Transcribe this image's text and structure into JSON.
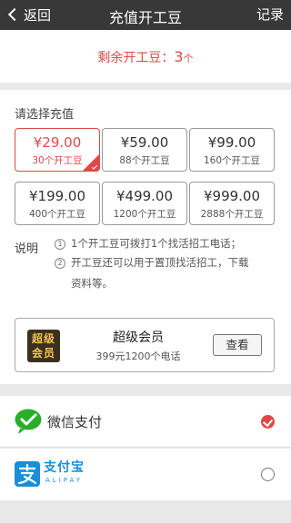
{
  "header": {
    "back_label": "返回",
    "title": "充值开工豆",
    "records_label": "记录"
  },
  "balance": {
    "label": "剩余开工豆：",
    "value": "3",
    "unit": "个"
  },
  "recharge": {
    "section_label": "请选择充值",
    "options": [
      {
        "price": "¥29.00",
        "beans": "30个开工豆",
        "selected": true
      },
      {
        "price": "¥59.00",
        "beans": "88个开工豆",
        "selected": false
      },
      {
        "price": "¥99.00",
        "beans": "160个开工豆",
        "selected": false
      },
      {
        "price": "¥199.00",
        "beans": "400个开工豆",
        "selected": false
      },
      {
        "price": "¥499.00",
        "beans": "1200个开工豆",
        "selected": false
      },
      {
        "price": "¥999.00",
        "beans": "2888个开工豆",
        "selected": false
      }
    ]
  },
  "notes": {
    "label": "说明",
    "items": [
      {
        "index": "1",
        "text": "1个开工豆可拨打1个找活招工电话；"
      },
      {
        "index": "2",
        "text": "开工豆还可以用于置顶找活招工，下载",
        "text2": "资料等。"
      }
    ]
  },
  "vip": {
    "logo_line1": "超级",
    "logo_line2": "会员",
    "name": "超级会员",
    "desc": "399元1200个电话",
    "button_label": "查看"
  },
  "payment": {
    "wechat": {
      "label": "微信支付",
      "checked": true
    },
    "alipay": {
      "logo_text": "支付宝",
      "logo_sub": "ALIPAY",
      "checked": false
    }
  },
  "colors": {
    "accent": "#e04848",
    "header_bg": "#383838",
    "wechat_green": "#2aae2a",
    "alipay_blue": "#1a8fd8"
  },
  "icons": {
    "back": "chevron-left-icon",
    "wechat": "wechat-pay-icon",
    "alipay": "alipay-icon",
    "selected": "check-icon"
  }
}
